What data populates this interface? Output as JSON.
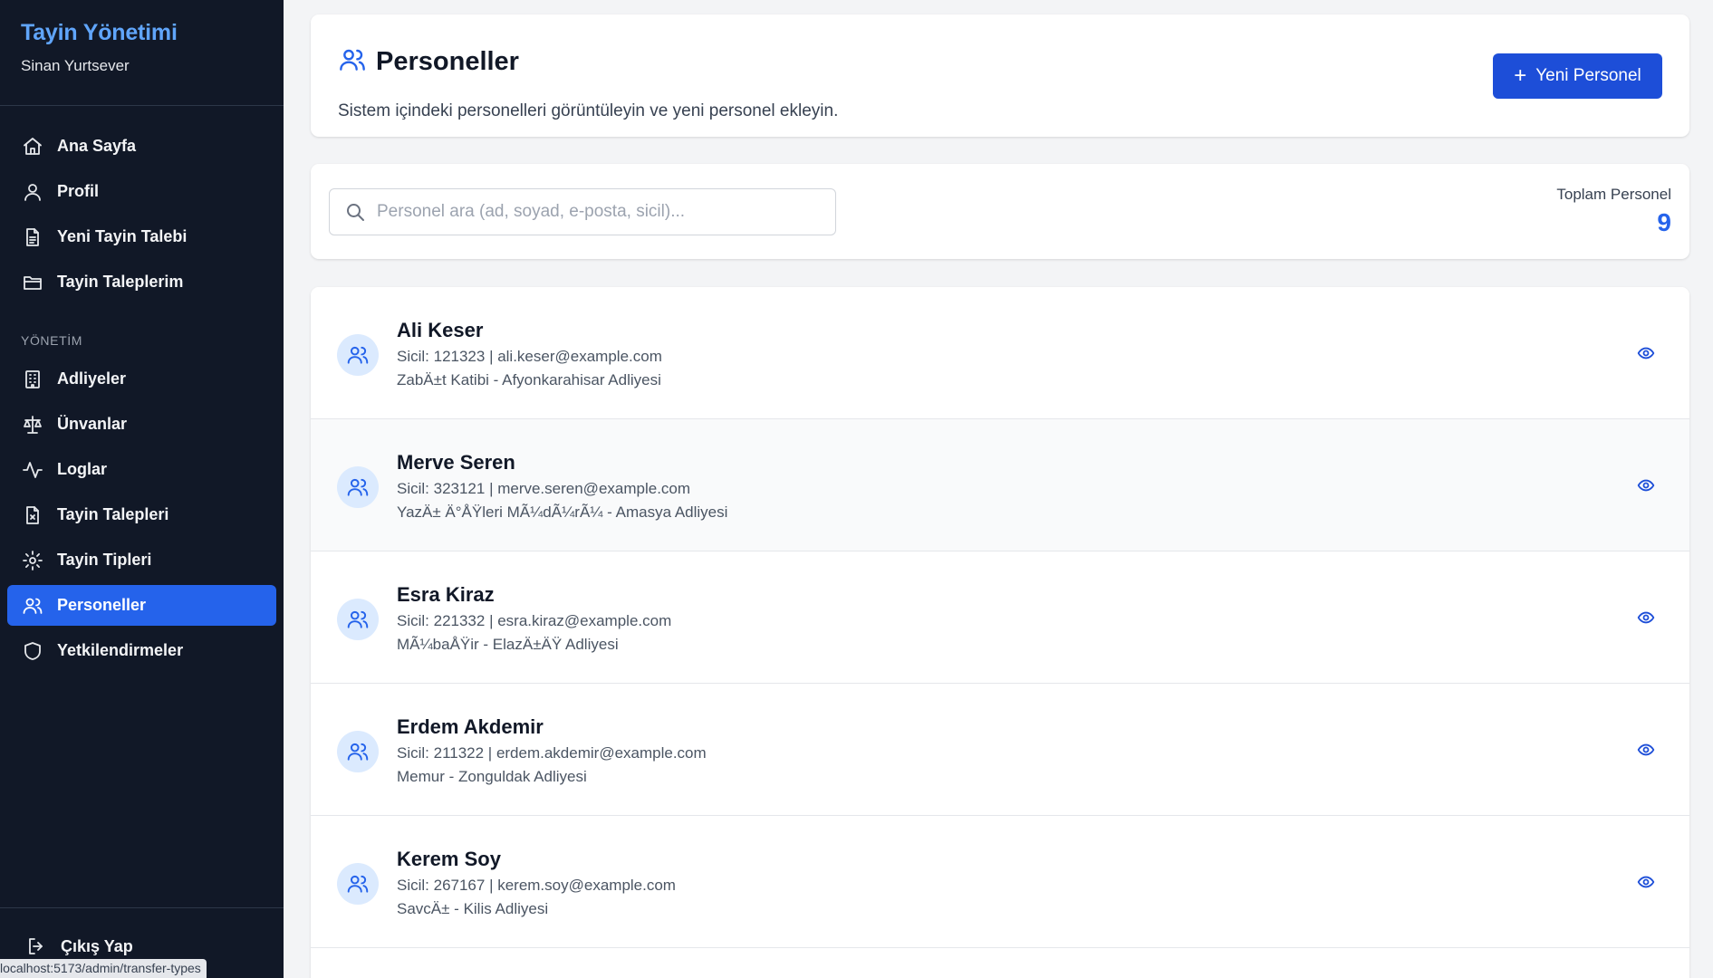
{
  "sidebar": {
    "brand": "Tayin Yönetimi",
    "user": "Sinan Yurtsever",
    "nav_items": [
      {
        "label": "Ana Sayfa",
        "icon": "home-icon"
      },
      {
        "label": "Profil",
        "icon": "user-icon"
      },
      {
        "label": "Yeni Tayin Talebi",
        "icon": "document-icon"
      },
      {
        "label": "Tayin Taleplerim",
        "icon": "folder-icon"
      }
    ],
    "section_label": "YÖNETİM",
    "admin_items": [
      {
        "label": "Adliyeler",
        "icon": "building-icon"
      },
      {
        "label": "Ünvanlar",
        "icon": "scale-icon"
      },
      {
        "label": "Loglar",
        "icon": "activity-icon"
      },
      {
        "label": "Tayin Talepleri",
        "icon": "file-x-icon"
      },
      {
        "label": "Tayin Tipleri",
        "icon": "gear-icon"
      },
      {
        "label": "Personeller",
        "icon": "users-icon",
        "active": true
      },
      {
        "label": "Yetkilendirmeler",
        "icon": "shield-icon"
      }
    ],
    "logout_label": "Çıkış Yap",
    "status_url": "localhost:5173/admin/transfer-types"
  },
  "header": {
    "title": "Personeller",
    "subtitle": "Sistem içindeki personelleri görüntüleyin ve yeni personel ekleyin.",
    "new_button_label": "Yeni Personel",
    "new_button_icon": "+"
  },
  "search": {
    "placeholder": "Personel ara (ad, soyad, e-posta, sicil)...",
    "value": ""
  },
  "total": {
    "label": "Toplam Personel",
    "value": "9"
  },
  "personnel": [
    {
      "name": "Ali Keser",
      "info": "Sicil: 121323 | ali.keser@example.com",
      "role": "ZabÄ±t Katibi - Afyonkarahisar Adliyesi"
    },
    {
      "name": "Merve Seren",
      "info": "Sicil: 323121 | merve.seren@example.com",
      "role": "YazÄ± Ä°ÅŸleri MÃ¼dÃ¼rÃ¼ - Amasya Adliyesi"
    },
    {
      "name": "Esra Kiraz",
      "info": "Sicil: 221332 | esra.kiraz@example.com",
      "role": "MÃ¼baÅŸir - ElazÄ±ÄŸ Adliyesi"
    },
    {
      "name": "Erdem Akdemir",
      "info": "Sicil: 211322 | erdem.akdemir@example.com",
      "role": "Memur - Zonguldak Adliyesi"
    },
    {
      "name": "Kerem Soy",
      "info": "Sicil: 267167 | kerem.soy@example.com",
      "role": "SavcÄ± - Kilis Adliyesi"
    }
  ],
  "colors": {
    "sidebar_bg": "#111827",
    "brand": "#60a5fa",
    "accent": "#2563eb",
    "button": "#1d4ed8",
    "page_bg": "#f3f4f6"
  }
}
